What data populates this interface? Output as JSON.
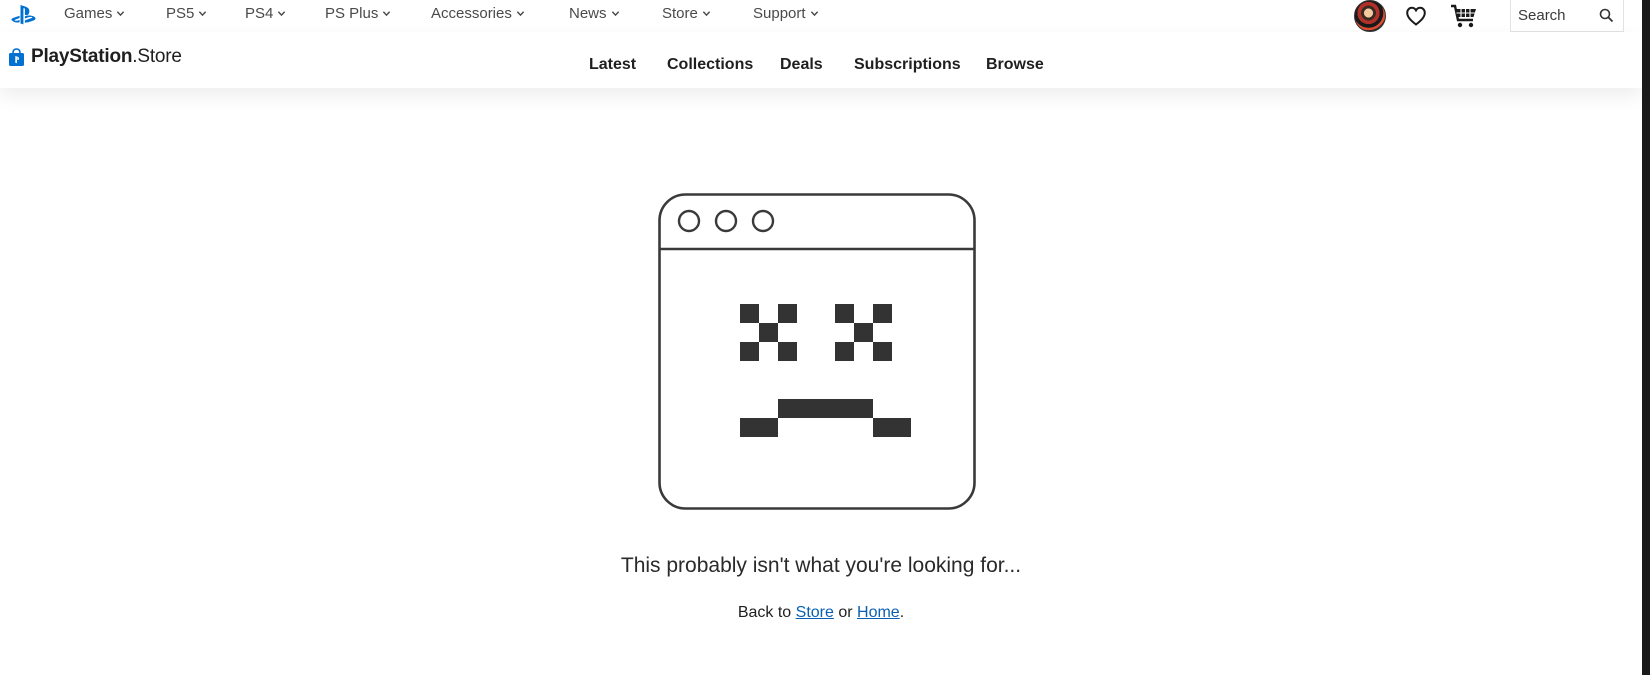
{
  "global_nav": {
    "items": [
      {
        "label": "Games"
      },
      {
        "label": "PS5"
      },
      {
        "label": "PS4"
      },
      {
        "label": "PS Plus"
      },
      {
        "label": "Accessories"
      },
      {
        "label": "News"
      },
      {
        "label": "Store"
      },
      {
        "label": "Support"
      }
    ],
    "search_placeholder": "Search",
    "icons": [
      "playstation-logo-icon",
      "avatar",
      "heart-icon",
      "cart-icon",
      "search-icon",
      "chevron-down-icon"
    ]
  },
  "store_header": {
    "logo_bold": "PlayStation",
    "logo_light": ".Store",
    "tabs": [
      {
        "label": "Latest"
      },
      {
        "label": "Collections"
      },
      {
        "label": "Deals"
      },
      {
        "label": "Subscriptions"
      },
      {
        "label": "Browse"
      }
    ]
  },
  "error": {
    "message": "This probably isn't what you're looking for...",
    "back_prefix": "Back to ",
    "store_link": "Store",
    "or_text": " or ",
    "home_link": "Home",
    "suffix": "."
  },
  "colors": {
    "accent": "#0070d1",
    "link": "#0a5fb4",
    "illustration": "#333333",
    "text": "#1f1f1f"
  }
}
